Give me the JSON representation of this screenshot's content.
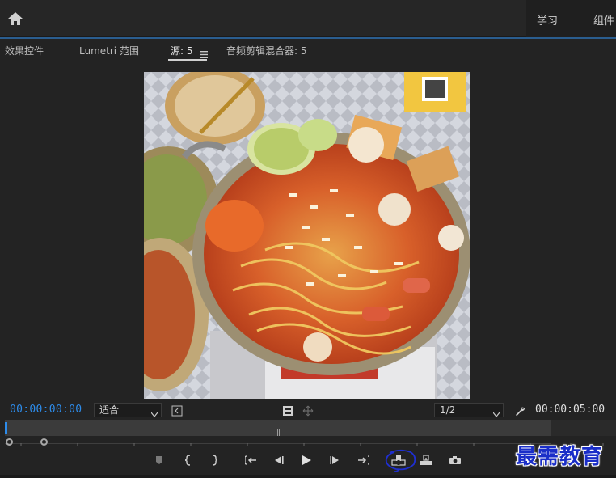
{
  "header": {
    "workspaces": [
      "学习",
      "组件"
    ]
  },
  "panel": {
    "tabs": [
      {
        "label": "效果控件"
      },
      {
        "label": "Lumetri 范围"
      },
      {
        "label": "源: 5"
      },
      {
        "label": "音频剪辑混合器: 5"
      }
    ],
    "active_tab": "源: 5"
  },
  "viewer": {
    "image_description_icon": "food-photo"
  },
  "controls": {
    "timecode_current": "00:00:00:00",
    "timecode_duration": "00:00:05:00",
    "zoom_select": "适合",
    "resolution_select": "1/2"
  },
  "watermark": {
    "text": "最需教育"
  },
  "colors": {
    "accent_blue": "#2d8ceb",
    "panel_bg": "#232323",
    "annotation_blue": "#1f2fd0"
  }
}
